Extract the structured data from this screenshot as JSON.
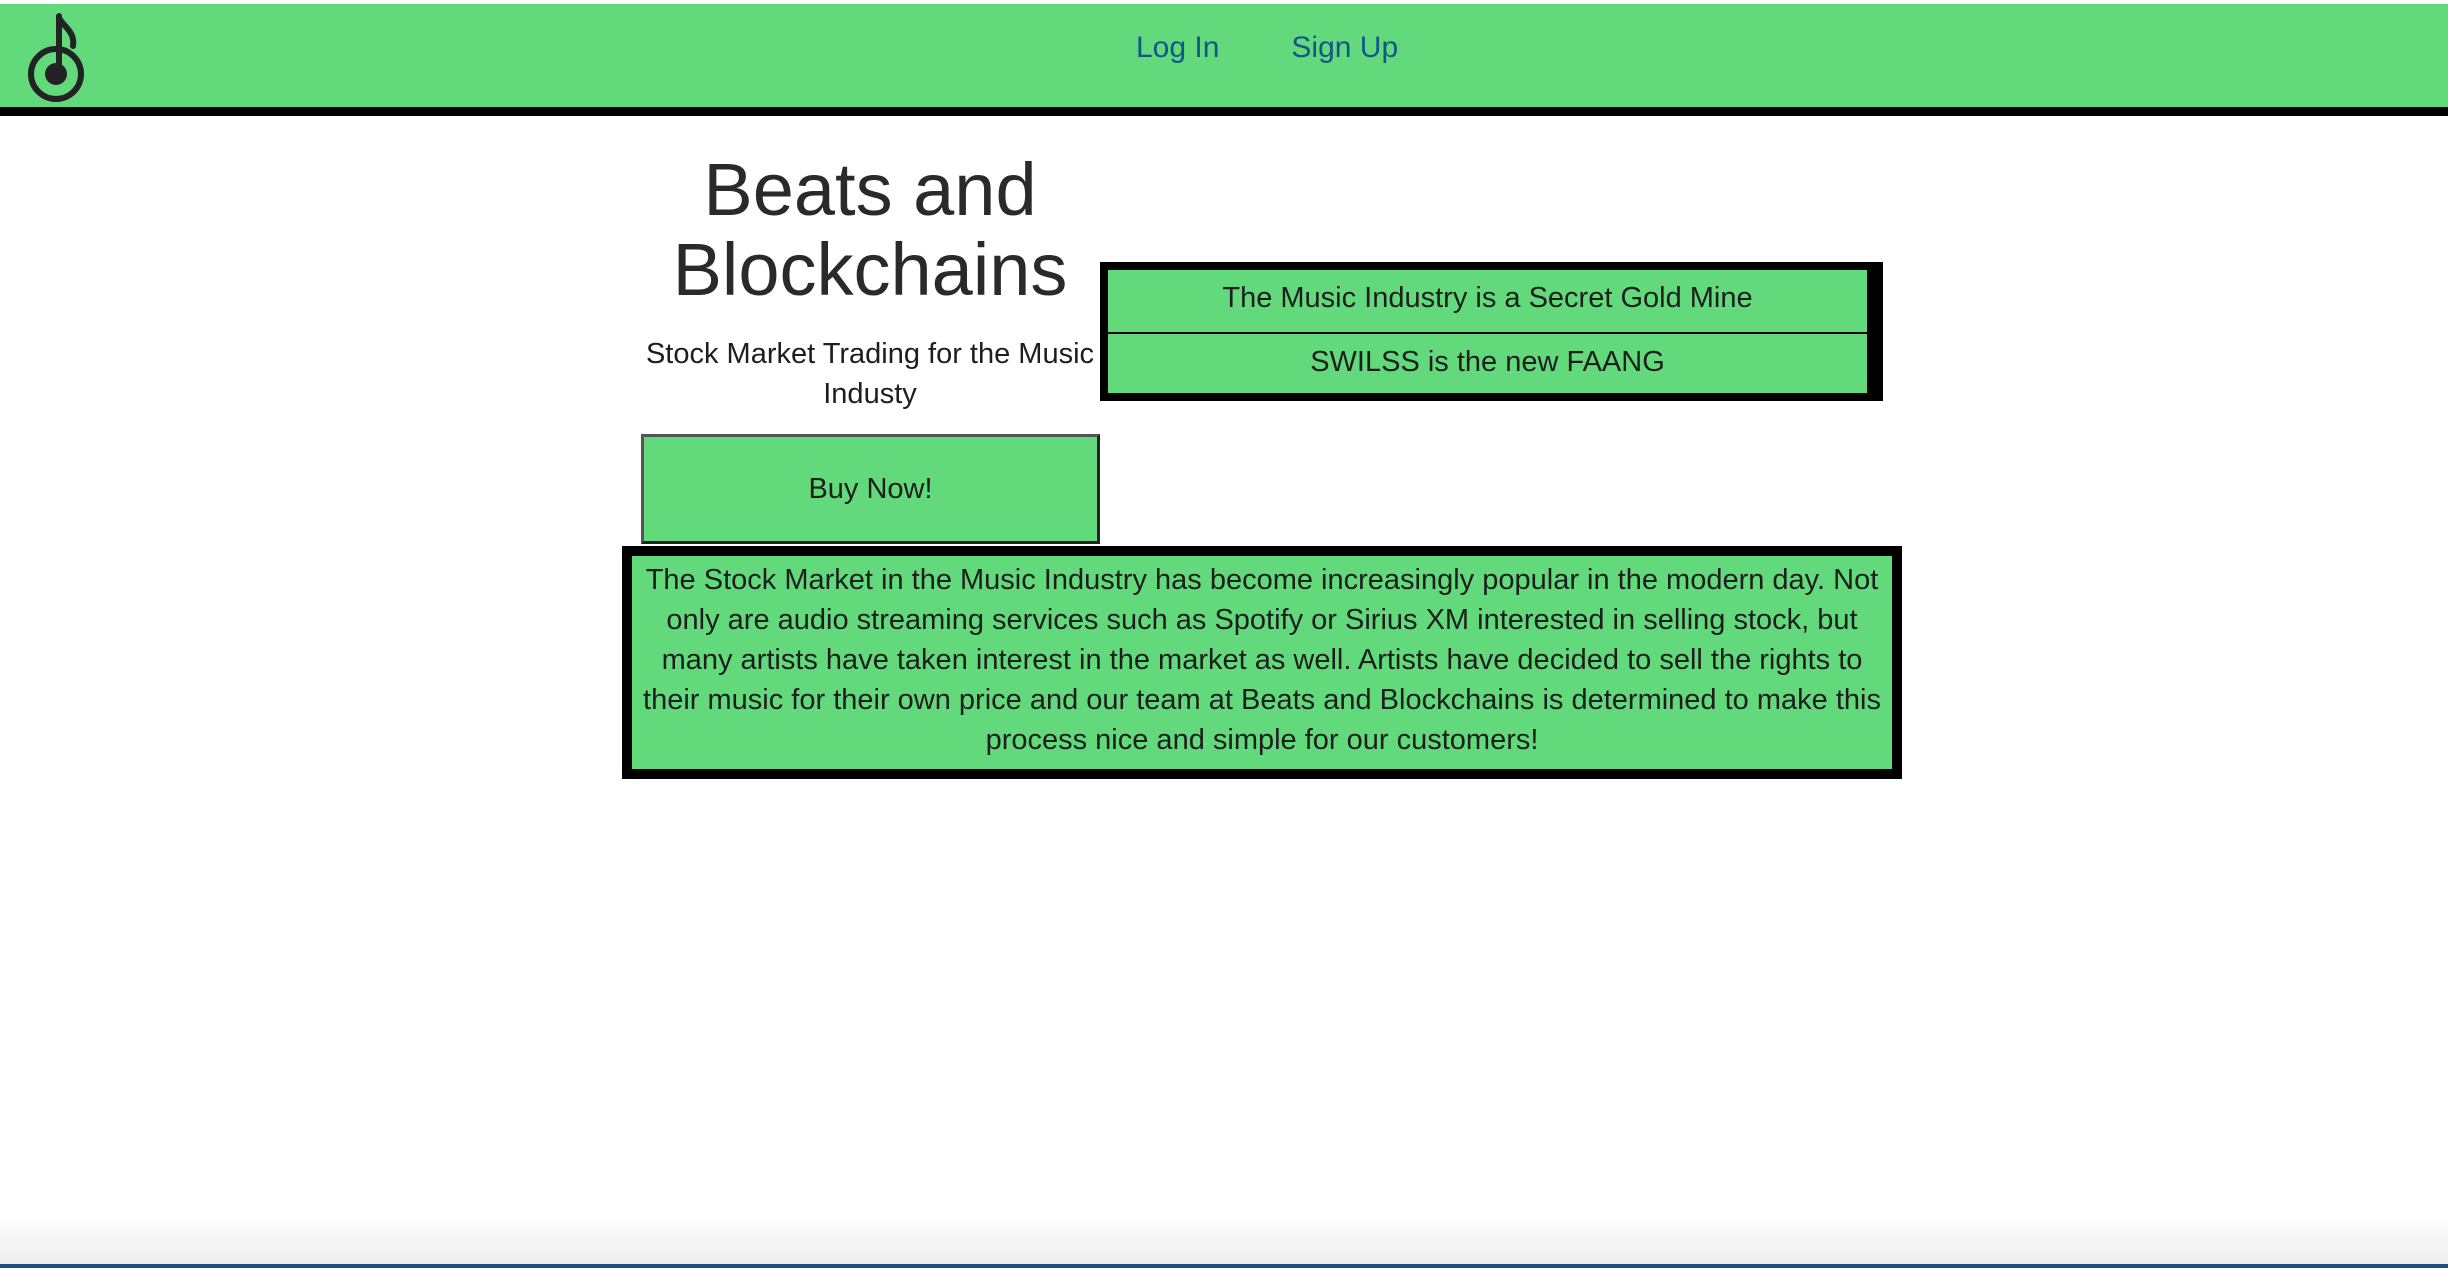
{
  "nav": {
    "logo_icon": "music-note-icon",
    "links": [
      {
        "label": "Log In"
      },
      {
        "label": "Sign Up"
      }
    ]
  },
  "hero": {
    "title": "Beats and Blockchains",
    "subtitle": "Stock Market Trading for the Music Industy",
    "buy_label": "Buy Now!"
  },
  "taglines": [
    "The Music Industry is a Secret Gold Mine",
    "SWILSS is the new FAANG"
  ],
  "about": {
    "text": "The Stock Market in the Music Industry has become increasingly popular in the modern day. Not only are audio streaming services such as Spotify or Sirius XM interested in selling stock, but many artists have taken interest in the market as well. Artists have decided to sell the rights to their music for their own price and our team at Beats and Blockchains is determined to make this process nice and simple for our customers!"
  },
  "colors": {
    "brand_green": "#62d97b",
    "link_blue": "#15568a",
    "border_black": "#000000"
  }
}
